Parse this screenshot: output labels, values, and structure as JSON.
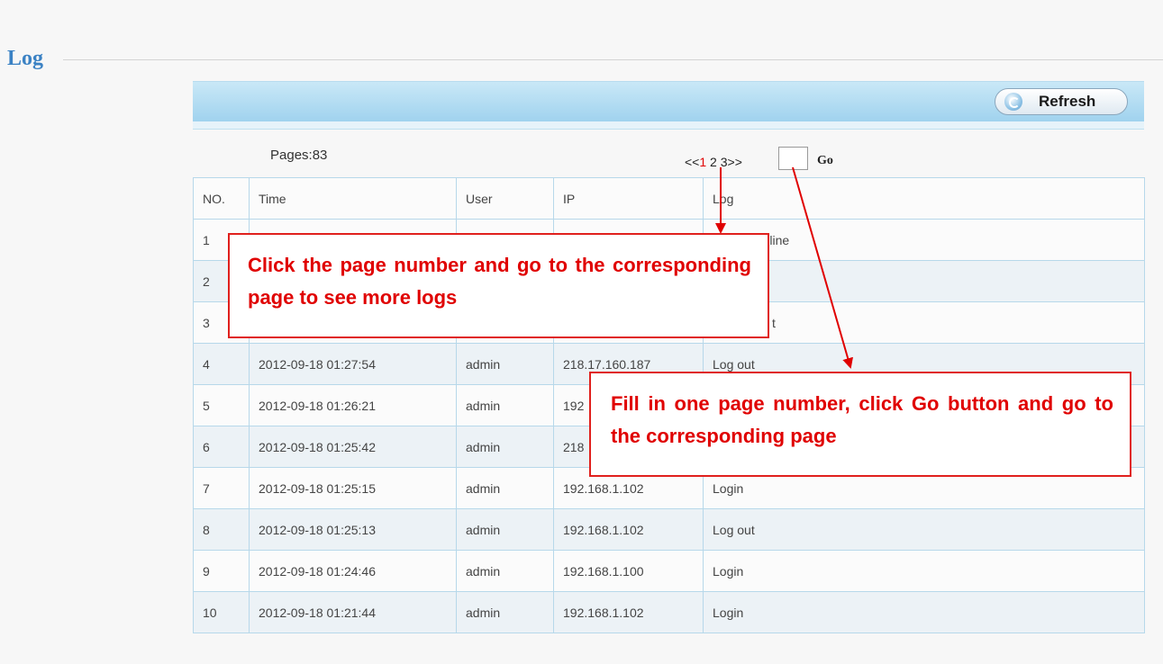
{
  "page": {
    "title": "Log"
  },
  "toolbar": {
    "refresh_label": "Refresh"
  },
  "pagination": {
    "pages_label": "Pages:83",
    "prev": "<<",
    "pages": [
      "1",
      "2",
      "3"
    ],
    "current_page": "1",
    "next": ">>",
    "page_input_value": "",
    "go_label": "Go"
  },
  "table": {
    "headers": [
      "NO.",
      "Time",
      "User",
      "IP",
      "Log"
    ],
    "rows": [
      {
        "no": "1",
        "time": "",
        "user": "",
        "ip": "",
        "log": "ff line"
      },
      {
        "no": "2",
        "time": "",
        "user": "",
        "ip": "",
        "log": ""
      },
      {
        "no": "3",
        "time": "",
        "user": "",
        "ip": "",
        "log": "t"
      },
      {
        "no": "4",
        "time": "2012-09-18 01:27:54",
        "user": "admin",
        "ip": "218.17.160.187",
        "log": "Log out"
      },
      {
        "no": "5",
        "time": "2012-09-18 01:26:21",
        "user": "admin",
        "ip": "192",
        "log": ""
      },
      {
        "no": "6",
        "time": "2012-09-18 01:25:42",
        "user": "admin",
        "ip": "218",
        "log": ""
      },
      {
        "no": "7",
        "time": "2012-09-18 01:25:15",
        "user": "admin",
        "ip": "192.168.1.102",
        "log": "Login"
      },
      {
        "no": "8",
        "time": "2012-09-18 01:25:13",
        "user": "admin",
        "ip": "192.168.1.102",
        "log": "Log out"
      },
      {
        "no": "9",
        "time": "2012-09-18 01:24:46",
        "user": "admin",
        "ip": "192.168.1.100",
        "log": "Login"
      },
      {
        "no": "10",
        "time": "2012-09-18 01:21:44",
        "user": "admin",
        "ip": "192.168.1.102",
        "log": "Login"
      }
    ]
  },
  "annotations": {
    "page_number_note": "Click the page number and go to the corresponding page to see more logs",
    "go_button_note": "Fill in one page number, click Go button and go to the corresponding page",
    "color": "#e00000"
  },
  "colors": {
    "title": "#3b82c4",
    "toolbar": "#a9d8f0",
    "grid_border": "#b7d8ea",
    "current_page": "#e00000"
  }
}
